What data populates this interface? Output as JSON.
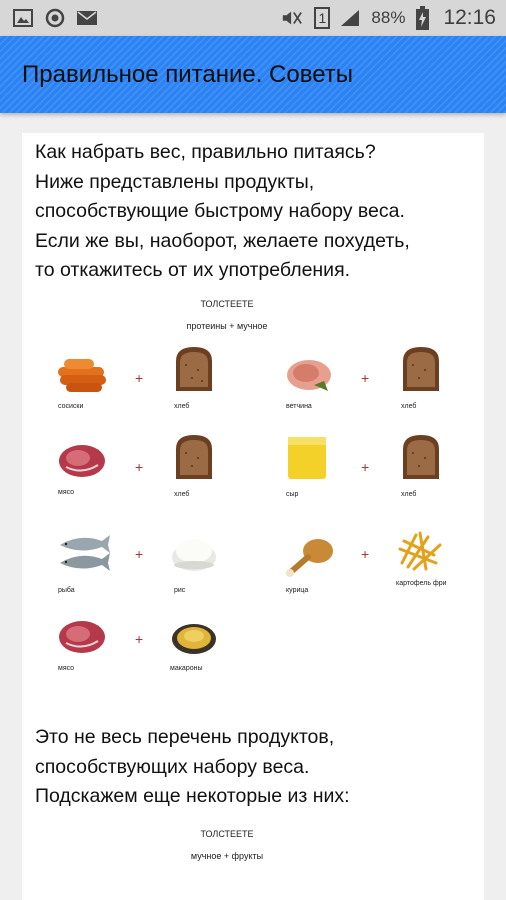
{
  "statusbar": {
    "battery_percent": "88%",
    "time": "12:16",
    "sim_slot": "1",
    "icons": [
      "image-icon",
      "sync-icon",
      "mail-icon",
      "mute-icon",
      "sim-icon",
      "signal-icon",
      "battery-charging-icon"
    ]
  },
  "appbar": {
    "title": "Правильное питание. Советы",
    "color": "#2a82f4"
  },
  "content": {
    "intro_lines": [
      "Как набрать вес, правильно питаясь?",
      "Ниже представлены продукты,",
      "способствующие быстрому набору веса.",
      "Если же вы, наоборот, желаете похудеть,",
      "то откажитесь от их употребления."
    ],
    "figure1": {
      "title": "ТОЛСТЕЕТЕ",
      "subtitle": "протеины + мучное",
      "plus": "+",
      "items": [
        {
          "label": "сосиски",
          "icon": "sausages-icon"
        },
        {
          "label": "хлеб",
          "icon": "bread-icon"
        },
        {
          "label": "ветчина",
          "icon": "ham-icon"
        },
        {
          "label": "хлеб",
          "icon": "bread-icon"
        },
        {
          "label": "мясо",
          "icon": "meat-icon"
        },
        {
          "label": "хлеб",
          "icon": "bread-icon"
        },
        {
          "label": "сыр",
          "icon": "cheese-icon"
        },
        {
          "label": "хлеб",
          "icon": "bread-icon"
        },
        {
          "label": "рыба",
          "icon": "fish-icon"
        },
        {
          "label": "рис",
          "icon": "rice-icon"
        },
        {
          "label": "курица",
          "icon": "chicken-leg-icon"
        },
        {
          "label": "картофель фри",
          "icon": "fries-icon"
        },
        {
          "label": "мясо",
          "icon": "meat-icon"
        },
        {
          "label": "макароны",
          "icon": "pasta-icon"
        }
      ]
    },
    "outro_lines": [
      "Это не весь перечень продуктов,",
      "способствующих набору веса.",
      "Подскажем еще некоторые из них:"
    ],
    "figure2": {
      "title": "ТОЛСТЕЕТЕ",
      "subtitle": "мучное + фрукты"
    }
  }
}
